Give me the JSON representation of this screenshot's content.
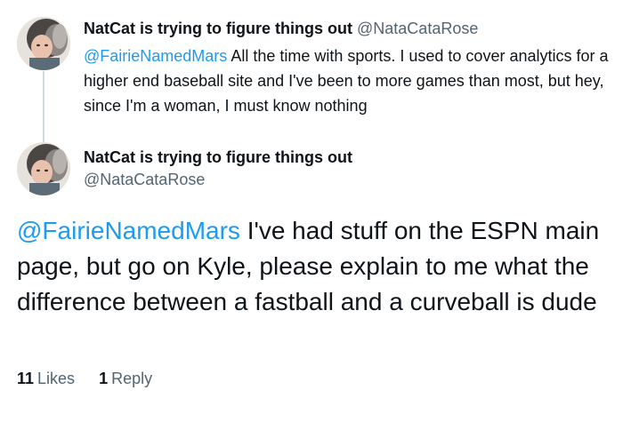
{
  "parent_tweet": {
    "display_name": "NatCat is trying to figure things out",
    "handle": "@NataCataRose",
    "mention": "@FairieNamedMars",
    "text": " All the time with sports. I used to cover analytics for a higher end baseball site and I've been to more games than most, but hey, since I'm a woman, I must know nothing"
  },
  "main_tweet": {
    "display_name": "NatCat is trying to figure things out",
    "handle": "@NataCataRose",
    "mention": "@FairieNamedMars",
    "text": " I've had stuff on the ESPN main page, but go on Kyle, please explain to me what the difference between a fastball and a curveball is dude"
  },
  "stats": {
    "likes_count": "11",
    "likes_label": "Likes",
    "replies_count": "1",
    "replies_label": "Reply"
  },
  "colors": {
    "mention": "#1d9bf0",
    "secondary_text": "#536471",
    "primary_text": "#0f1419",
    "thread_line": "#cfd9de"
  },
  "icons": {
    "avatar": "profile-photo"
  }
}
